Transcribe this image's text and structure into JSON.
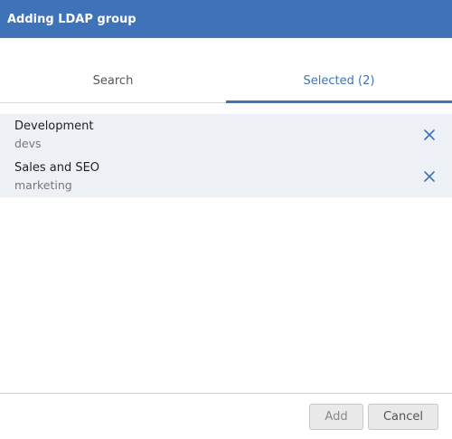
{
  "dialog": {
    "title": "Adding LDAP group"
  },
  "tabs": [
    {
      "label": "Search",
      "active": false
    },
    {
      "label": "Selected (2)",
      "active": true
    }
  ],
  "selected_groups": [
    {
      "name": "Development",
      "id": "devs"
    },
    {
      "name": "Sales and SEO",
      "id": "marketing"
    }
  ],
  "footer": {
    "add_label": "Add",
    "cancel_label": "Cancel"
  },
  "colors": {
    "accent": "#3f73b8",
    "row_bg": "#edf1f6"
  },
  "icons": {
    "remove": "close-icon"
  }
}
